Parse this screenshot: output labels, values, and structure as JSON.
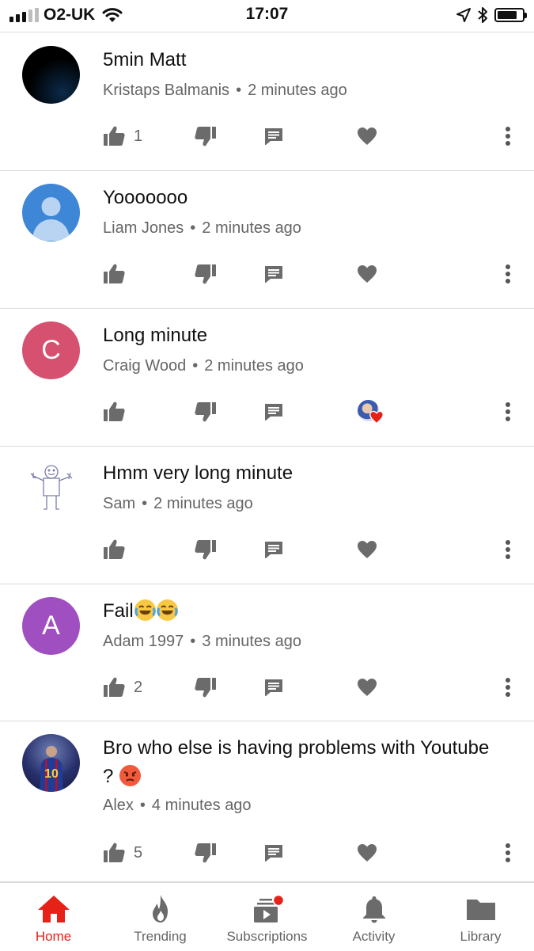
{
  "status_bar": {
    "carrier": "O2-UK",
    "time": "17:07",
    "signal_bars": 3,
    "signal_total": 5,
    "battery_level": 0.8
  },
  "comments": [
    {
      "text": "5min Matt",
      "author": "Kristaps Balmanis",
      "time": "2 minutes ago",
      "likes": "1",
      "avatar_type": "dark-circle",
      "hearted": false
    },
    {
      "text": "Yooooooo",
      "author": "Liam Jones",
      "time": "2 minutes ago",
      "likes": "",
      "avatar_type": "default-person",
      "hearted": false
    },
    {
      "text": "Long minute",
      "author": "Craig Wood",
      "time": "2 minutes ago",
      "likes": "",
      "avatar_type": "letter",
      "avatar_letter": "C",
      "avatar_color": "#d6506f",
      "hearted": true
    },
    {
      "text": "Hmm very long minute",
      "author": "Sam",
      "time": "2 minutes ago",
      "likes": "",
      "avatar_type": "stick-figure",
      "hearted": false
    },
    {
      "text": "Fail",
      "author": "Adam 1997",
      "time": "3 minutes ago",
      "likes": "2",
      "avatar_type": "letter",
      "avatar_letter": "A",
      "avatar_color": "#a04fc1",
      "hearted": false,
      "emojis": [
        "laughing-crying-emoji",
        "laughing-crying-emoji"
      ]
    },
    {
      "text_line1": "Bro who else is having problems with Youtube",
      "text_line2": "?",
      "author": "Alex",
      "time": "4 minutes ago",
      "likes": "5",
      "avatar_type": "photo-jersey",
      "avatar_number": "10",
      "hearted": false,
      "emojis": [
        "angry-face-emoji"
      ]
    }
  ],
  "separator": "•",
  "nav": {
    "items": [
      {
        "label": "Home",
        "icon": "home-icon",
        "active": true
      },
      {
        "label": "Trending",
        "icon": "flame-icon",
        "active": false
      },
      {
        "label": "Subscriptions",
        "icon": "subscriptions-icon",
        "active": false,
        "badge": true
      },
      {
        "label": "Activity",
        "icon": "bell-icon",
        "active": false
      },
      {
        "label": "Library",
        "icon": "folder-icon",
        "active": false
      }
    ]
  },
  "colors": {
    "icon_gray": "#6b6b6b",
    "accent_red": "#e62117",
    "divider": "#dcdcdc",
    "meta_text": "#666666"
  }
}
